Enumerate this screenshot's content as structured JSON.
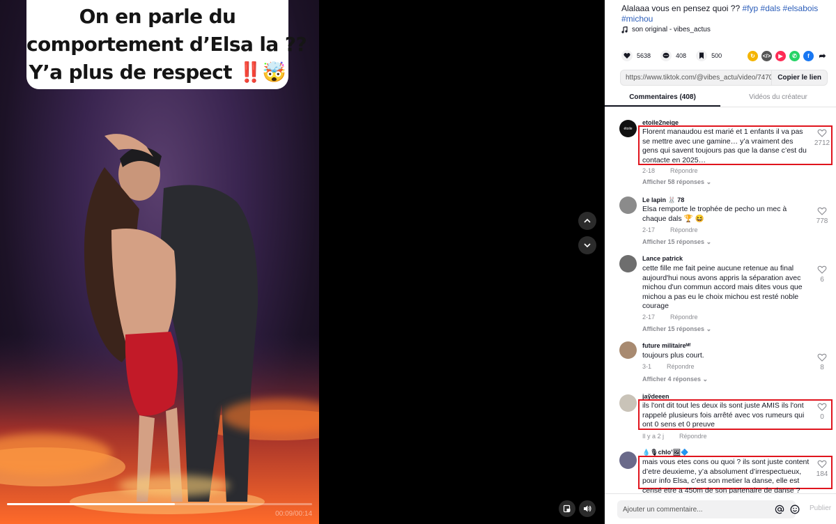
{
  "video": {
    "caption_lines": [
      "On en parle du",
      "comportement d’Elsa la ??",
      "Y’a plus de respect"
    ],
    "caption_emoji": "‼️🤯",
    "progress_fraction": 0.55,
    "time_display": "00:09/00:14"
  },
  "post": {
    "description": "Alalaaa vous en pensez quoi ??",
    "hashtags": [
      "#fyp",
      "#dals",
      "#elsabois",
      "#michou"
    ],
    "music": "son original - vibes_actus"
  },
  "actions": {
    "likes": "5638",
    "comments": "408",
    "saves": "500"
  },
  "share_icons": [
    "clip-share-icon",
    "embed-icon",
    "send-icon",
    "whatsapp-icon",
    "facebook-icon",
    "share-arrow-icon"
  ],
  "link": {
    "url": "https://www.tiktok.com/@vibes_actu/video/74706...",
    "copy_label": "Copier le lien"
  },
  "tabs": [
    {
      "label": "Commentaires (408)",
      "active": true
    },
    {
      "label": "Vidéos du créateur",
      "active": false
    }
  ],
  "comments": [
    {
      "user": "etoile2neige",
      "text": "Florent manaudou est marié et 1 enfants il va pas se mettre avec une gamine… y’a vraiment des gens qui savent toujours pas que la danse c’est du contacte en 2025…",
      "date": "2-18",
      "reply_label": "Répondre",
      "replies": "Afficher 58 réponses",
      "likes": "2712",
      "highlighted": true
    },
    {
      "user": "Le lapin 🐰 78",
      "text": "Elsa remporte le trophée de pecho un mec à chaque dals 🏆 😆",
      "date": "2-17",
      "reply_label": "Répondre",
      "replies": "Afficher 15 réponses",
      "likes": "778",
      "highlighted": false
    },
    {
      "user": "Lance patrick",
      "text": "cette fille me fait peine aucune retenue au final aujourd'hui nous avons appris la séparation avec michou d'un commun accord mais dites vous que michou a pas eu le choix michou est resté noble courage",
      "date": "2-17",
      "reply_label": "Répondre",
      "replies": "Afficher 15 réponses",
      "likes": "6",
      "highlighted": false
    },
    {
      "user": "future militaireᴹᶠ",
      "text": "toujours plus court.",
      "date": "3-1",
      "reply_label": "Répondre",
      "replies": "Afficher 4 réponses",
      "likes": "8",
      "highlighted": false
    },
    {
      "user": "jay̆deeen",
      "text": "ils l'ont dit tout les deux ils sont juste AMIS ils l'ont rappelé plusieurs fois arrêté avec vos rumeurs qui ont 0 sens et 0 preuve",
      "date": "Il y a 2 j",
      "reply_label": "Répondre",
      "replies": "",
      "likes": "0",
      "highlighted": true
    },
    {
      "user": "💧🎙chlo’🖼🔷",
      "text": "mais vous etes cons ou quoi ? ils sont juste content d’etre deuxieme, y’a absolument d’irrespectueux, pour info Elsa, c’est son metier la danse, elle est censé etre a 450m de son partenaire de danse ?",
      "date": "",
      "reply_label": "",
      "replies": "",
      "likes": "184",
      "highlighted": true
    }
  ],
  "comment_input": {
    "placeholder": "Ajouter un commentaire...",
    "publish_label": "Publier"
  }
}
